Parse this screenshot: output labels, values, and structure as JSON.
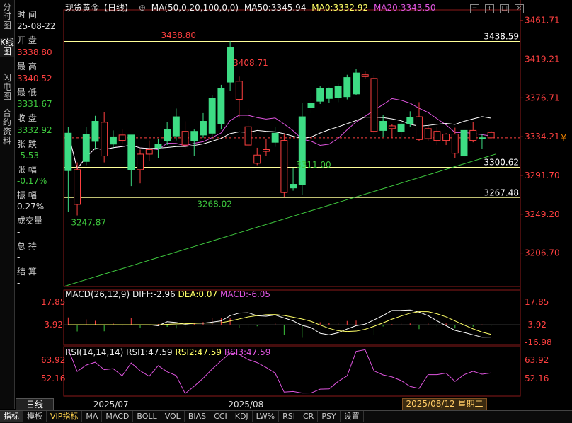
{
  "left_tabs": [
    "分时图",
    "K线图",
    "闪电图",
    "合约资料"
  ],
  "info": {
    "time_label": "时 间",
    "time_value": "25-08-22",
    "open_label": "开 盘",
    "open_value": "3338.80",
    "high_label": "最 高",
    "high_value": "3340.52",
    "low_label": "最 低",
    "low_value": "3331.67",
    "close_label": "收 盘",
    "close_value": "3332.92",
    "chg_label": "张 跌",
    "chg_value": "-5.53",
    "pct_label": "张 幅",
    "pct_value": "-0.17%",
    "amp_label": "振 幅",
    "amp_value": "0.27%",
    "vol_label": "成交量",
    "vol_value": "-",
    "hold_label": "总 持",
    "hold_value": "-",
    "settle_label": "结 算",
    "settle_value": "-"
  },
  "header": {
    "title": "现货黄金【日线】",
    "ma_params": "MA(50,0,20,100,0,0)",
    "ma50": "MA50:3345.94",
    "ma0": "MA0:3332.92",
    "ma20": "MA20:3343.50"
  },
  "macd_header": {
    "name": "MACD(26,12,9)",
    "diff": "DIFF:-2.96",
    "dea": "DEA:0.07",
    "macd": "MACD:-6.05"
  },
  "rsi_header": {
    "name": "RSI(14,14,14)",
    "rsi1": "RSI1:47.59",
    "rsi2": "RSI2:47.59",
    "rsi3": "RSI3:47.59"
  },
  "bottom_tabs": [
    "指标",
    "模板",
    "VIP指标",
    "MA",
    "MACD",
    "BOLL",
    "VOL",
    "BIAS",
    "CCI",
    "KDJ",
    "LW%",
    "RSI",
    "CR",
    "PSY",
    "设置"
  ],
  "day_tab": "日线",
  "date_flag": "2025/08/12 星期二",
  "colors": {
    "up": "#3ec83e",
    "down": "#ff4040",
    "candle_up": "#3ddc84",
    "ma50": "#ffffff",
    "ma20": "#e055e0",
    "ma100": "#3ec83e",
    "level": "#ffff99"
  },
  "chart_data": {
    "type": "candlestick",
    "price_axis": {
      "ticks": [
        3461.71,
        3419.21,
        3376.71,
        3334.21,
        3291.7,
        3249.2,
        3206.7
      ],
      "ylim": [
        3170,
        3470
      ]
    },
    "last_price_tag": "3334.21",
    "levels": [
      {
        "label": "3438.59",
        "value": 3438.59
      },
      {
        "label": "3300.62",
        "value": 3300.62
      },
      {
        "label": "3267.48",
        "value": 3267.48
      }
    ],
    "annotations": [
      {
        "label": "3438.80",
        "value": 3438.8,
        "index": 10
      },
      {
        "label": "3408.71",
        "value": 3408.71,
        "index": 18
      },
      {
        "label": "3247.87",
        "value": 3247.87,
        "index": 0
      },
      {
        "label": "3268.02",
        "value": 3268.02,
        "index": 14
      },
      {
        "label": "3311.00",
        "value": 3311.0,
        "index": 25
      }
    ],
    "x_labels": [
      {
        "label": "2025/07",
        "index": 2
      },
      {
        "label": "2025/08",
        "index": 17
      }
    ],
    "candles": [
      {
        "o": 3297,
        "h": 3345,
        "l": 3252,
        "c": 3338,
        "dir": "up"
      },
      {
        "o": 3298,
        "h": 3306,
        "l": 3247.87,
        "c": 3260,
        "dir": "down"
      },
      {
        "o": 3307,
        "h": 3345,
        "l": 3303,
        "c": 3337,
        "dir": "up"
      },
      {
        "o": 3329,
        "h": 3357,
        "l": 3320,
        "c": 3351,
        "dir": "up"
      },
      {
        "o": 3350,
        "h": 3361,
        "l": 3306,
        "c": 3313,
        "dir": "down"
      },
      {
        "o": 3326,
        "h": 3341,
        "l": 3321,
        "c": 3334,
        "dir": "up"
      },
      {
        "o": 3336,
        "h": 3342,
        "l": 3326,
        "c": 3330,
        "dir": "down"
      },
      {
        "o": 3298,
        "h": 3328,
        "l": 3280,
        "c": 3336,
        "dir": "up"
      },
      {
        "o": 3315,
        "h": 3320,
        "l": 3283,
        "c": 3298,
        "dir": "down"
      },
      {
        "o": 3320,
        "h": 3330,
        "l": 3308,
        "c": 3315,
        "dir": "down"
      },
      {
        "o": 3322,
        "h": 3332,
        "l": 3311,
        "c": 3326,
        "dir": "up"
      },
      {
        "o": 3342,
        "h": 3350,
        "l": 3325,
        "c": 3330,
        "dir": "up"
      },
      {
        "o": 3356,
        "h": 3365,
        "l": 3330,
        "c": 3335,
        "dir": "up"
      },
      {
        "o": 3340,
        "h": 3351,
        "l": 3321,
        "c": 3325,
        "dir": "down"
      },
      {
        "o": 3330,
        "h": 3342,
        "l": 3313,
        "c": 3340,
        "dir": "up"
      },
      {
        "o": 3336,
        "h": 3360,
        "l": 3333,
        "c": 3351,
        "dir": "up"
      },
      {
        "o": 3338,
        "h": 3380,
        "l": 3331,
        "c": 3376,
        "dir": "up"
      },
      {
        "o": 3348,
        "h": 3391,
        "l": 3342,
        "c": 3387,
        "dir": "up"
      },
      {
        "o": 3394,
        "h": 3438.8,
        "l": 3384,
        "c": 3432,
        "dir": "up"
      },
      {
        "o": 3395,
        "h": 3400,
        "l": 3355,
        "c": 3375,
        "dir": "down"
      },
      {
        "o": 3345,
        "h": 3365,
        "l": 3322,
        "c": 3325,
        "dir": "down"
      },
      {
        "o": 3314,
        "h": 3322,
        "l": 3303,
        "c": 3305,
        "dir": "down"
      },
      {
        "o": 3320,
        "h": 3332,
        "l": 3313,
        "c": 3318,
        "dir": "down"
      },
      {
        "o": 3328,
        "h": 3345,
        "l": 3323,
        "c": 3338,
        "dir": "up"
      },
      {
        "o": 3330,
        "h": 3337,
        "l": 3268.02,
        "c": 3273,
        "dir": "down"
      },
      {
        "o": 3282,
        "h": 3300,
        "l": 3275,
        "c": 3278,
        "dir": "up"
      },
      {
        "o": 3356,
        "h": 3371,
        "l": 3270,
        "c": 3282,
        "dir": "up"
      },
      {
        "o": 3371,
        "h": 3381,
        "l": 3360,
        "c": 3366,
        "dir": "up"
      },
      {
        "o": 3373,
        "h": 3390,
        "l": 3370,
        "c": 3387,
        "dir": "up"
      },
      {
        "o": 3376,
        "h": 3388,
        "l": 3371,
        "c": 3387,
        "dir": "up"
      },
      {
        "o": 3377,
        "h": 3392,
        "l": 3372,
        "c": 3389,
        "dir": "up"
      },
      {
        "o": 3378,
        "h": 3402,
        "l": 3375,
        "c": 3399,
        "dir": "up"
      },
      {
        "o": 3381,
        "h": 3408.71,
        "l": 3380,
        "c": 3404,
        "dir": "up"
      },
      {
        "o": 3402,
        "h": 3406,
        "l": 3398,
        "c": 3400,
        "dir": "down"
      },
      {
        "o": 3398,
        "h": 3402,
        "l": 3337,
        "c": 3340,
        "dir": "down"
      },
      {
        "o": 3351,
        "h": 3358,
        "l": 3334,
        "c": 3341,
        "dir": "up"
      },
      {
        "o": 3343,
        "h": 3348,
        "l": 3333,
        "c": 3346,
        "dir": "down"
      },
      {
        "o": 3340,
        "h": 3352,
        "l": 3331,
        "c": 3348,
        "dir": "up"
      },
      {
        "o": 3348,
        "h": 3362,
        "l": 3345,
        "c": 3355,
        "dir": "up"
      },
      {
        "o": 3356,
        "h": 3372,
        "l": 3329,
        "c": 3331,
        "dir": "down"
      },
      {
        "o": 3332,
        "h": 3346,
        "l": 3330,
        "c": 3343,
        "dir": "down"
      },
      {
        "o": 3340,
        "h": 3345,
        "l": 3325,
        "c": 3330,
        "dir": "down"
      },
      {
        "o": 3330,
        "h": 3338,
        "l": 3325,
        "c": 3337,
        "dir": "down"
      },
      {
        "o": 3337,
        "h": 3344,
        "l": 3311,
        "c": 3316,
        "dir": "down"
      },
      {
        "o": 3313,
        "h": 3344,
        "l": 3311,
        "c": 3341,
        "dir": "up"
      },
      {
        "o": 3341,
        "h": 3350,
        "l": 3328,
        "c": 3330,
        "dir": "down"
      },
      {
        "o": 3332,
        "h": 3337,
        "l": 3321,
        "c": 3333,
        "dir": "up"
      },
      {
        "o": 3338.8,
        "h": 3340.52,
        "l": 3331.67,
        "c": 3332.92,
        "dir": "down"
      }
    ],
    "macd": {
      "ticks": [
        17.85,
        -3.92,
        -16.98
      ]
    },
    "rsi": {
      "ticks": [
        63.92,
        52.16
      ]
    }
  }
}
